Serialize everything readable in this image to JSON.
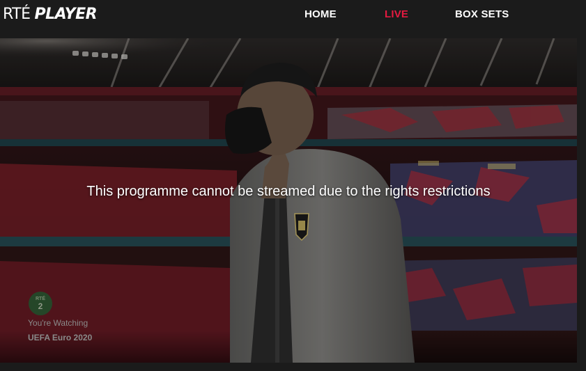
{
  "header": {
    "logo_rte": "RTÉ",
    "logo_player": "PLAYER",
    "nav": {
      "home": "HOME",
      "live": "LIVE",
      "box_sets": "BOX SETS"
    },
    "live_color": "#e51a40"
  },
  "player": {
    "message": "This programme cannot be streamed due to the rights restrictions",
    "channel_badge": {
      "top": "RTÉ",
      "number": "2"
    },
    "watching_label": "You're Watching",
    "programme_title": "UEFA Euro 2020",
    "channel_color": "#1e4f2b"
  }
}
